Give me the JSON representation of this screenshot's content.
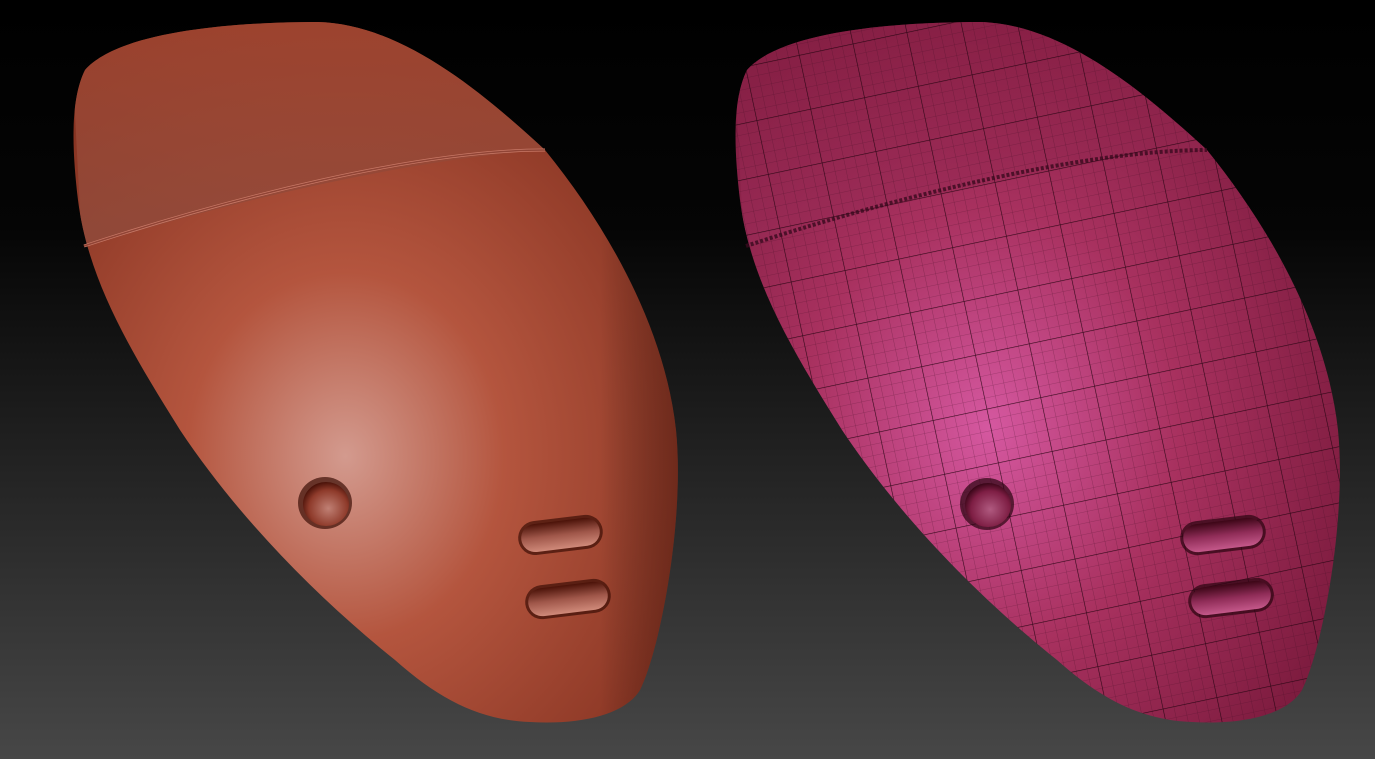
{
  "scene": {
    "background": {
      "top_color": "#000000",
      "bottom_color": "#474747"
    },
    "models": [
      {
        "id": "clay-shell",
        "material": "matte-clay",
        "base_color": "#b4553e",
        "highlight_color": "#d39a8e",
        "shadow_color": "#6e2316",
        "wireframe": false
      },
      {
        "id": "wireframe-shell",
        "material": "polyframe-overlay",
        "base_color": "#a8315f",
        "highlight_color": "#d558a0",
        "shadow_color": "#5c0f2c",
        "wireframe": true,
        "wire_color": "#2a0516"
      }
    ],
    "features": [
      "seam-ridge",
      "round-recess",
      "slot-recess",
      "slot-recess"
    ]
  }
}
